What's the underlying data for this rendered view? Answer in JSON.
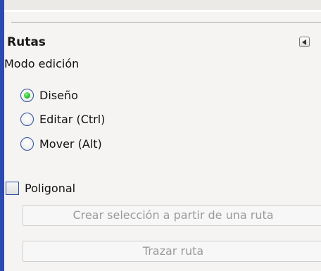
{
  "panel": {
    "title": "Rutas",
    "mode_label": "Modo edición",
    "modes": [
      {
        "label": "Diseño",
        "checked": true
      },
      {
        "label": "Editar (Ctrl)",
        "checked": false
      },
      {
        "label": "Mover (Alt)",
        "checked": false
      }
    ],
    "polygonal": {
      "label": "Poligonal",
      "checked": false
    },
    "buttons": {
      "create_selection": "Crear selección a partir de una ruta",
      "stroke_path": "Trazar ruta"
    }
  },
  "colors": {
    "left_edge": "#2c4bb1",
    "radio_checked": "#2bbf2b"
  }
}
